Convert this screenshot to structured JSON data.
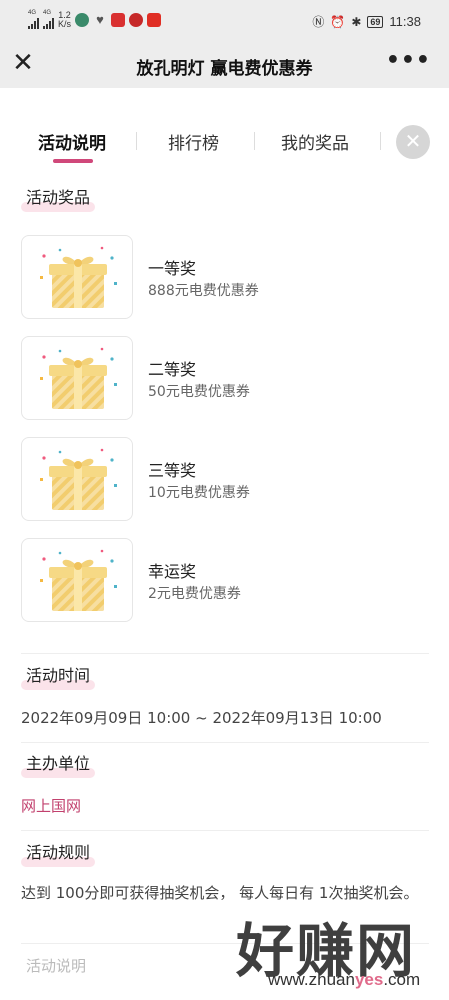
{
  "status_bar": {
    "network_top": "4G",
    "network_top2": "4G",
    "speed_value": "1.2",
    "speed_unit": "K/s",
    "battery": "69",
    "time": "11:38"
  },
  "title_bar": {
    "close_glyph": "✕",
    "title": "放孔明灯 赢电费优惠券",
    "more_glyph": "•••"
  },
  "tabs": {
    "items": [
      "活动说明",
      "排行榜",
      "我的奖品"
    ],
    "active_index": 0,
    "close_glyph": "✕",
    "accent_color": "#d0487a"
  },
  "prizes_section": {
    "title": "活动奖品",
    "items": [
      {
        "name": "一等奖",
        "desc": "888元电费优惠券",
        "icon": "gift-box-icon"
      },
      {
        "name": "二等奖",
        "desc": "50元电费优惠券",
        "icon": "gift-box-icon"
      },
      {
        "name": "三等奖",
        "desc": "10元电费优惠券",
        "icon": "gift-box-icon"
      },
      {
        "name": "幸运奖",
        "desc": "2元电费优惠券",
        "icon": "gift-box-icon"
      }
    ]
  },
  "time_section": {
    "title": "活动时间",
    "value": "2022年09月09日 10:00 ~ 2022年09月13日 10:00"
  },
  "organizer_section": {
    "title": "主办单位",
    "value": "网上国网"
  },
  "rules_section": {
    "title": "活动规则",
    "value": "达到 100分即可获得抽奖机会， 每人每日有 1次抽奖机会。"
  },
  "footer": {
    "label": "活动说明"
  },
  "watermark": {
    "logo_text": "好赚网",
    "site_prefix": "www.zhuan",
    "site_highlight": "yes",
    "site_suffix": ".com"
  }
}
